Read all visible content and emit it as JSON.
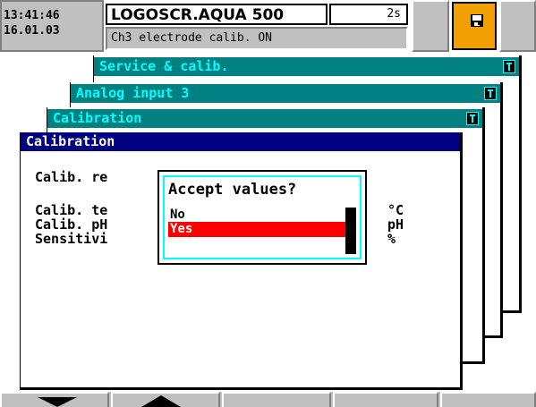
{
  "header": {
    "time": "13:41:46",
    "date": "16.01.03",
    "device_name": "LOGOSCR.AQUA 500",
    "interval": "2s",
    "status_message": "Ch3 electrode calib. ON",
    "save_icon": "floppy-disk-icon",
    "save_button_color": "#f0a000"
  },
  "windows": [
    {
      "title": "Service & calib.",
      "icon": "info-icon"
    },
    {
      "title": "Analog input 3",
      "icon": "info-icon"
    },
    {
      "title": "Calibration",
      "icon": "info-icon"
    }
  ],
  "main": {
    "title": "Calibration",
    "rows": [
      {
        "label": "Calib. re",
        "unit": ""
      },
      {
        "label": "Calib. te",
        "unit": "°C"
      },
      {
        "label": "Calib. pH",
        "unit": "pH"
      },
      {
        "label": "Sensitivi",
        "unit": "%"
      }
    ]
  },
  "dialog": {
    "title": "Accept values?",
    "options": [
      "No",
      "Yes"
    ],
    "selected": "Yes",
    "selected_color": "#ff0000",
    "frame_color": "#00ffff"
  },
  "softkeys": [
    {
      "icon": "arrow-down-icon"
    },
    {
      "icon": "arrow-up-icon"
    },
    {
      "icon": ""
    },
    {
      "icon": ""
    },
    {
      "icon": ""
    }
  ],
  "colors": {
    "window_title_bg": "#008080",
    "window_title_fg": "#00ffff",
    "active_title_bg": "#000080"
  }
}
